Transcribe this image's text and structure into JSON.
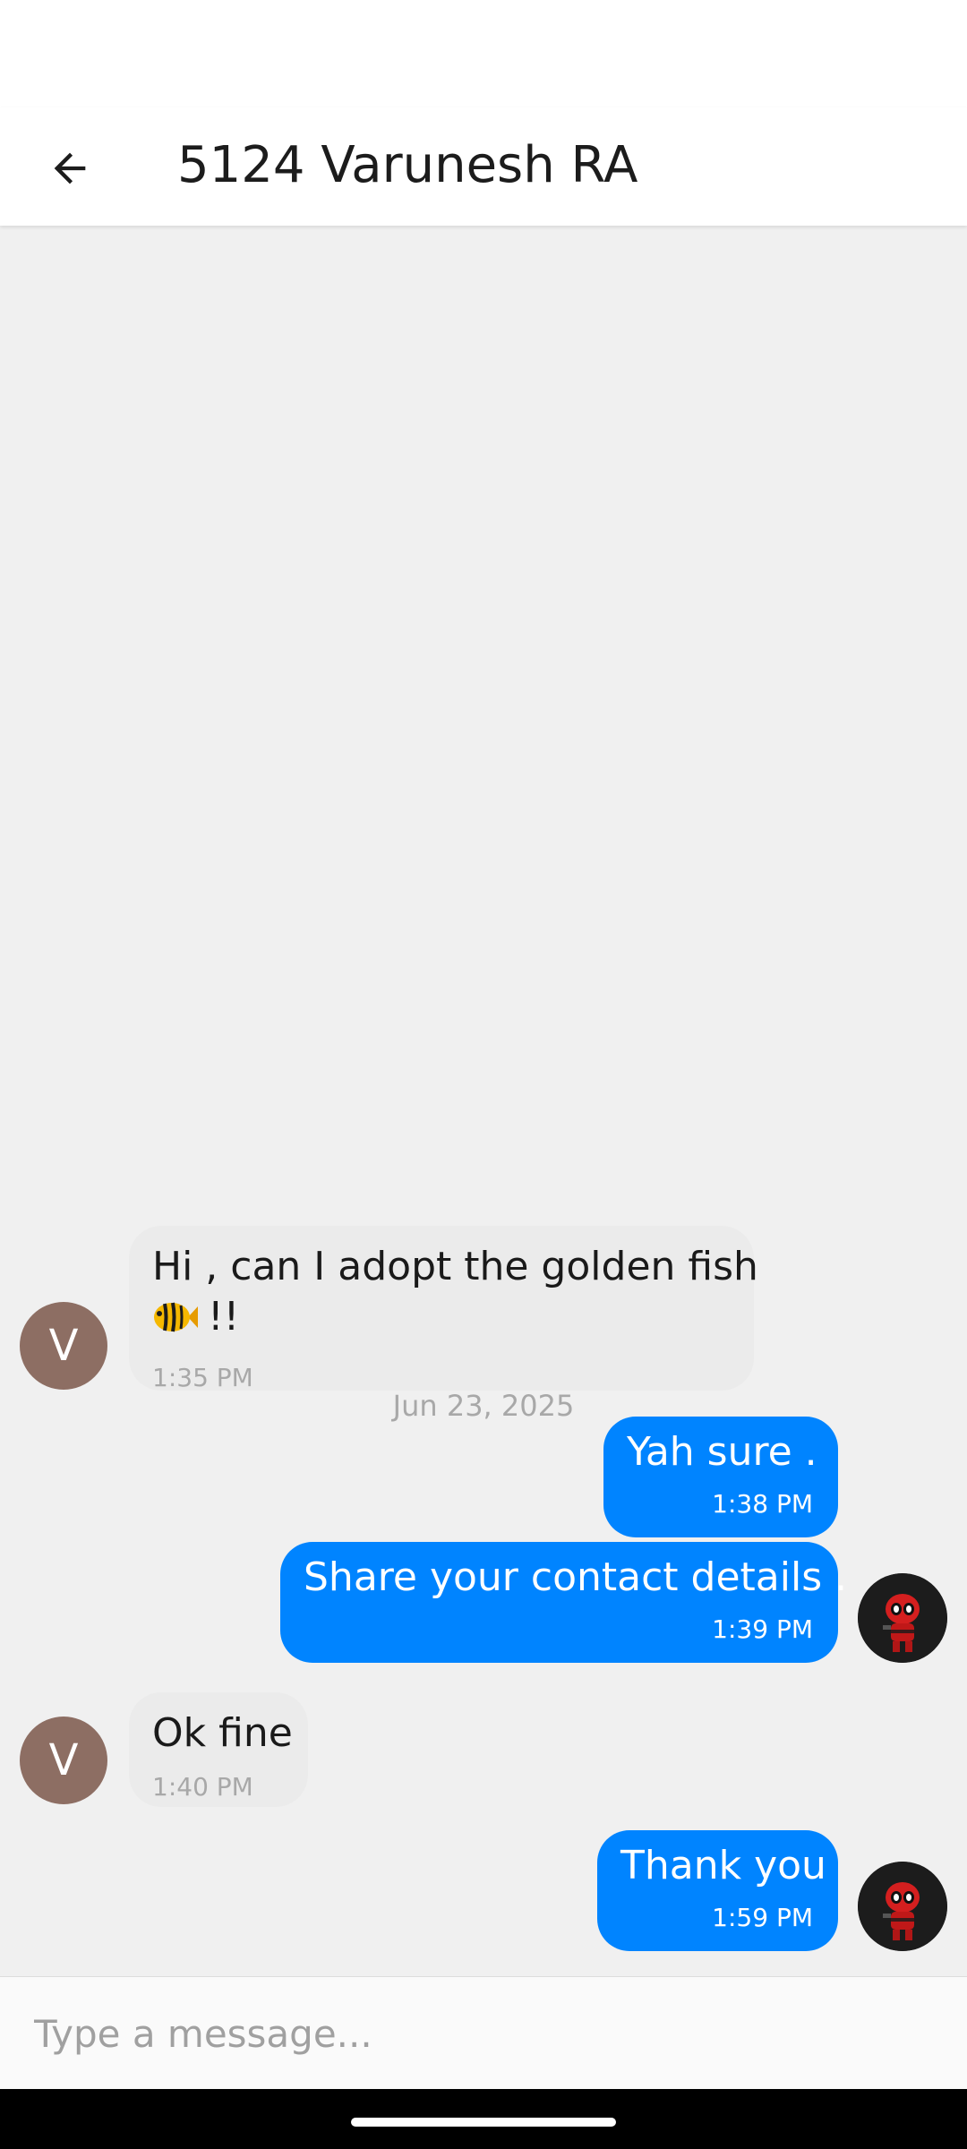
{
  "header": {
    "title": "5124 Varunesh RA",
    "back_icon": "arrow-left-icon"
  },
  "chat": {
    "date_separator": "Jun 23, 2025",
    "contact_avatar_initial": "V",
    "my_avatar_icon": "deadpool-avatar-icon",
    "messages": [
      {
        "direction": "incoming",
        "text": "Hi , can I adopt the golden fish",
        "text_line2": "!!",
        "emoji_icon": "tropical-fish-icon",
        "time": "1:35 PM"
      },
      {
        "direction": "outgoing",
        "text": "Yah sure .",
        "time": "1:38 PM"
      },
      {
        "direction": "outgoing",
        "text": "Share your contact details .",
        "time": "1:39 PM"
      },
      {
        "direction": "incoming",
        "text": "Ok fine",
        "time": "1:40 PM"
      },
      {
        "direction": "outgoing",
        "text": "Thank you",
        "time": "1:59 PM"
      }
    ]
  },
  "composer": {
    "placeholder": "Type a message...",
    "value": ""
  },
  "colors": {
    "outgoing_bubble": "#0084ff",
    "incoming_bubble": "#ebebeb",
    "avatar_bg": "#8d6e63",
    "chat_background": "#f0f0f0"
  }
}
